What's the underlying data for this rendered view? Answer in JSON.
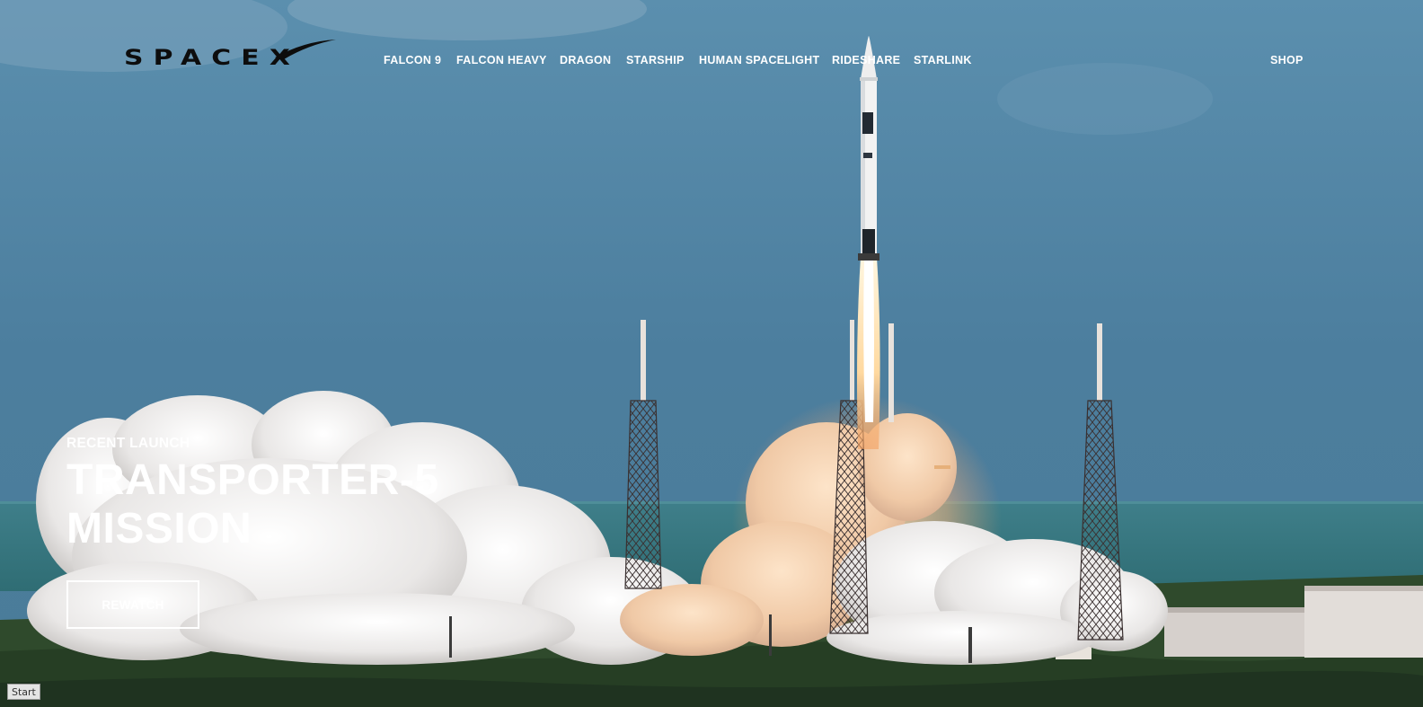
{
  "brand": {
    "logo_text": "SPACEX"
  },
  "nav": {
    "items": [
      {
        "label": "FALCON 9"
      },
      {
        "label": "FALCON HEAVY"
      },
      {
        "label": "DRAGON"
      },
      {
        "label": "STARSHIP"
      },
      {
        "label": "HUMAN SPACELIGHT"
      },
      {
        "label": "RIDESHARE"
      },
      {
        "label": "STARLINK"
      }
    ],
    "shop_label": "SHOP"
  },
  "hero": {
    "eyebrow": "RECENT LAUNCH",
    "title_line1": "TRANSPORTER-5",
    "title_line2": "MISSION",
    "cta_label": "REWATCH",
    "image_subject": "falcon-9-rocket-launch-photo"
  },
  "taskbar": {
    "start_label": "Start"
  },
  "colors": {
    "sky": "#4d7f9f",
    "text": "#ffffff",
    "logo": "#0d0d0d"
  }
}
